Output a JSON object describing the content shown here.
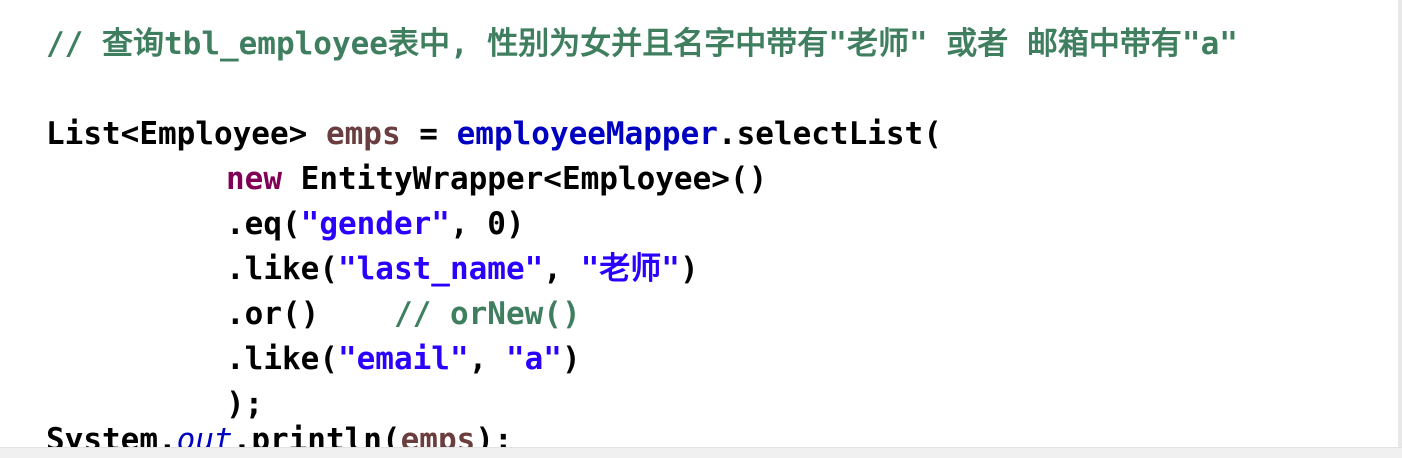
{
  "code": {
    "comment_line": "// 查询tbl_employee表中, 性别为女并且名字中带有\"老师\" 或者 邮箱中带有\"a\"",
    "line1": {
      "type": "List<Employee>",
      "var": "emps",
      "assign": " = ",
      "mapper": "employeeMapper",
      "call": ".selectList("
    },
    "line2": {
      "keyword": "new",
      "rest": " EntityWrapper<Employee>()"
    },
    "line3": {
      "method": ".eq(",
      "arg1": "\"gender\"",
      "sep": ", 0)"
    },
    "line4": {
      "method": ".like(",
      "arg1": "\"last_name\"",
      "sep": ", ",
      "arg2": "\"老师\"",
      "close": ")"
    },
    "line5": {
      "method": ".or()",
      "gap": "    ",
      "comment": "// orNew()"
    },
    "line6": {
      "method": ".like(",
      "arg1": "\"email\"",
      "sep": ", ",
      "arg2": "\"a\"",
      "close": ")"
    },
    "line7": {
      "close": ");"
    },
    "line8": {
      "prefix": "System.",
      "field": "out",
      "call": ".println(",
      "arg": "emps",
      "close": ");"
    }
  },
  "colors": {
    "comment": "#3f7f5f",
    "keyword": "#7f0055",
    "field": "#0000c0",
    "string": "#2a00ff",
    "local": "#6a3e3e"
  }
}
